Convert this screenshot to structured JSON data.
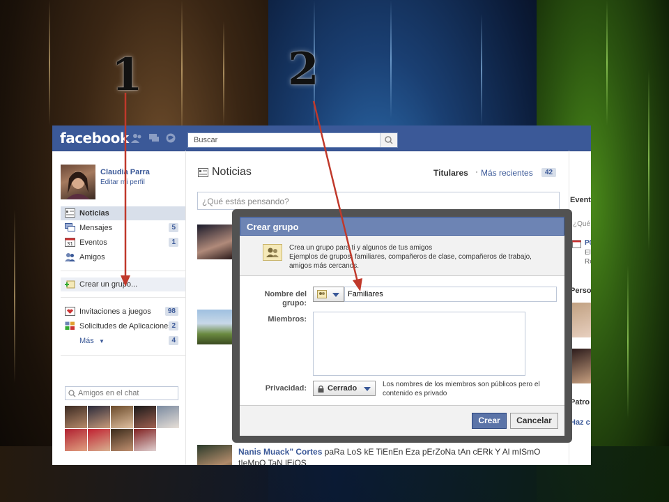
{
  "steps": {
    "one": "1",
    "two": "2"
  },
  "topbar": {
    "logo": "facebook",
    "search_placeholder": "Buscar"
  },
  "profile": {
    "name": "Claudia Parra",
    "edit": "Editar mi perfil"
  },
  "nav": [
    {
      "label": "Noticias",
      "count": ""
    },
    {
      "label": "Mensajes",
      "count": "5"
    },
    {
      "label": "Eventos",
      "count": "1"
    },
    {
      "label": "Amigos",
      "count": ""
    }
  ],
  "create_group": "Crear un grupo...",
  "apps": [
    {
      "label": "Invitaciones a juegos",
      "count": "98"
    },
    {
      "label": "Solicitudes de Aplicaciones",
      "count": "2"
    },
    {
      "label": "Más",
      "count": "4"
    }
  ],
  "chat": {
    "placeholder": "Amigos en el chat"
  },
  "feed": {
    "title": "Noticias",
    "titulares": "Titulares",
    "recientes": "Más recientes",
    "recientes_count": "42",
    "status_placeholder": "¿Qué estás pensando?",
    "story_author": "Nanis Muack\" Cortes",
    "story_text": " paRa LoS kE TiEnEn Eza pErZoNa tAn cERk Y Al mISmO tIeMpO TaN lEjOS"
  },
  "right": {
    "events": "Event",
    "status_stub": "¿Qué",
    "event_stub1": "P0",
    "event_stub2": "El",
    "event_stub3": "Re",
    "people": "Perso",
    "patro": "Patro",
    "hazc": "Haz c"
  },
  "dialog": {
    "title": "Crear grupo",
    "info1": "Crea un grupo para ti y algunos de tus amigos",
    "info2": "Ejemplos de grupos: familiares, compañeros de clase, compañeros de trabajo, amigos más cercanos.",
    "name_label": "Nombre del grupo:",
    "name_value": "Familiares",
    "members_label": "Miembros:",
    "privacy_label": "Privacidad:",
    "privacy_value": "Cerrado",
    "privacy_note": "Los nombres de los miembros son públicos pero el contenido es privado",
    "create_button": "Crear",
    "cancel_button": "Cancelar"
  },
  "colors": {
    "fb_blue": "#3b5998",
    "annotation_red": "#c0392b"
  }
}
